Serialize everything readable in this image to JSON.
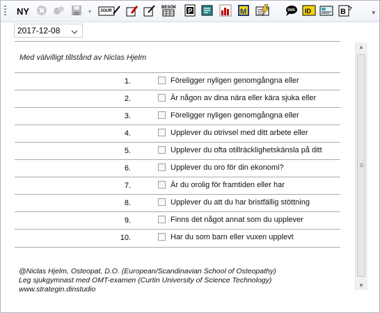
{
  "toolbar": {
    "new_label": "NY",
    "icons": [
      {
        "name": "cancel-icon",
        "text": ""
      },
      {
        "name": "settings-icon",
        "text": ""
      },
      {
        "name": "save-icon",
        "text": ""
      },
      {
        "name": "journal-icon",
        "text": "JOUR"
      },
      {
        "name": "edit-pencil-icon",
        "text": ""
      },
      {
        "name": "checkbox-edit-icon",
        "text": ""
      },
      {
        "name": "visit-icon",
        "text": "BESÖK"
      },
      {
        "name": "p-document-icon",
        "text": "P"
      },
      {
        "name": "notes-icon",
        "text": ""
      },
      {
        "name": "chart-icon",
        "text": ""
      },
      {
        "name": "m-icon",
        "text": "M"
      },
      {
        "name": "lightning-icon",
        "text": ""
      },
      {
        "name": "sms-icon",
        "text": "SMS"
      },
      {
        "name": "id-icon",
        "text": "ID"
      },
      {
        "name": "card-icon",
        "text": ""
      },
      {
        "name": "b-icon",
        "text": "B"
      }
    ]
  },
  "date": {
    "value": "2017-12-08"
  },
  "credit": "Med välvilligt tillstånd av Niclas Hjelm",
  "questions": [
    {
      "num": "1.",
      "text": "Föreligger nyligen genomgångna eller"
    },
    {
      "num": "2.",
      "text": "Är någon av dina nära eller kära sjuka eller"
    },
    {
      "num": "3.",
      "text": "Föreligger nyligen genomgångna eller"
    },
    {
      "num": "4.",
      "text": "Upplever du otrivsel med ditt arbete eller"
    },
    {
      "num": "5.",
      "text": "Upplever du ofta otillräcklighetskänsla på ditt"
    },
    {
      "num": "6.",
      "text": "Upplever du oro för din ekonomi?"
    },
    {
      "num": "7.",
      "text": "Är du orolig för framtiden eller har"
    },
    {
      "num": "8.",
      "text": "Upplever du att du har bristfällig stöttning"
    },
    {
      "num": "9.",
      "text": "Finns det något annat som du upplever"
    },
    {
      "num": "10.",
      "text": "Har du som barn eller vuxen upplevt"
    }
  ],
  "footer": {
    "line1": "@Niclas Hjelm, Osteopat, D.O. (European/Scandinavian School of Osteopathy)",
    "line2": "Leg sjukgymnast med OMT-examen (Curtin University of Science  Technology)",
    "line3": "www.strategin.dinstudio"
  },
  "colors": {
    "accent": "#1f3d8a",
    "border": "#a9a9a9",
    "background": "#ffffff"
  }
}
